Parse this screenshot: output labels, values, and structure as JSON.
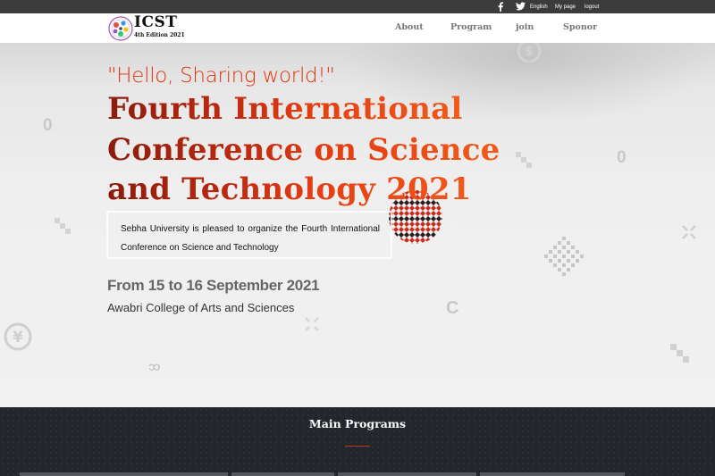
{
  "topbar": {
    "facebook_icon": "facebook-icon",
    "twitter_icon": "twitter-icon",
    "language": "English",
    "my_page": "My page",
    "logout": "logout"
  },
  "logo": {
    "name": "ICST",
    "edition": "4th Edition 2021"
  },
  "nav": {
    "items": [
      {
        "label": "About"
      },
      {
        "label": "Program"
      },
      {
        "label": "join"
      },
      {
        "label": "Sponor"
      }
    ]
  },
  "hero": {
    "tagline": "\"Hello, Sharing world!\"",
    "title_lines": [
      "Fourth International",
      "Conference on Science",
      "and Technology 2021"
    ],
    "description": "Sebha University is pleased to organize the Fourth International Conference on Science and Technology",
    "dates": "From 15 to 16 September 2021",
    "venue": "Awabri College of Arts and Sciences",
    "decor_glyphs": [
      "0",
      "0",
      "$",
      "¥",
      "C"
    ]
  },
  "programs": {
    "heading": "Main Programs",
    "accent_color": "#b33a1b"
  },
  "colors": {
    "topbar_bg": "#3b3b3b",
    "title_gradient_start": "#8a1c0c",
    "title_gradient_end": "#f25a1a",
    "tagline": "#e2320e",
    "programs_bg": "#24262e"
  }
}
